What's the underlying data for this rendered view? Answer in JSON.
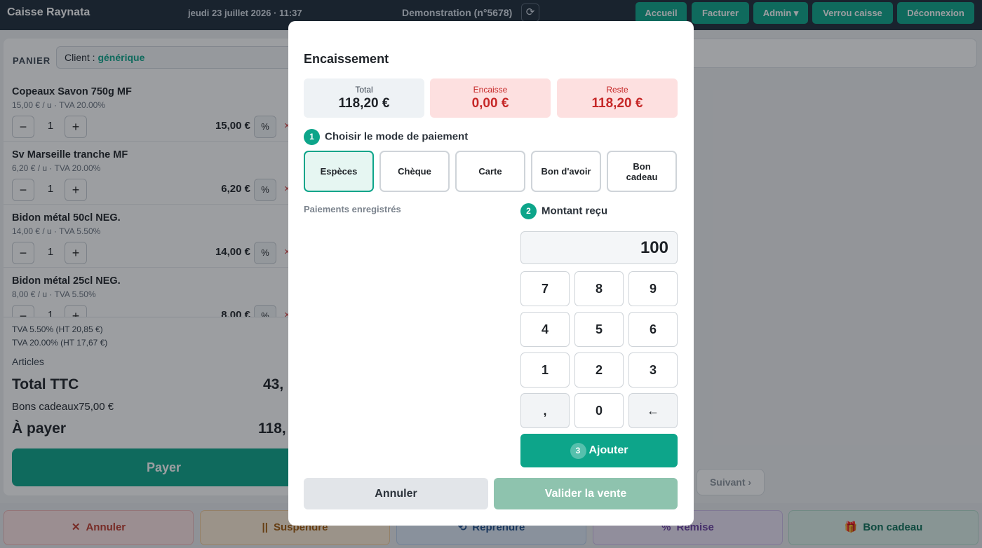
{
  "header": {
    "brand": "Caisse Raynata",
    "datetime": "jeudi 23 juillet 2026 · 11:37",
    "store": "Demonstration (n°5678)",
    "nav": [
      "Accueil",
      "Facturer",
      "Admin ▾",
      "Verrou caisse",
      "Déconnexion"
    ]
  },
  "cart": {
    "label": "PANIER",
    "client_prefix": "Client : ",
    "client_value": "générique",
    "items": [
      {
        "name": "Copeaux Savon 750g MF",
        "sub": "15,00 € / u · TVA 20.00%",
        "qty": "1",
        "price": "15,00 €"
      },
      {
        "name": "Sv Marseille tranche MF",
        "sub": "6,20 € / u · TVA 20.00%",
        "qty": "1",
        "price": "6,20 €"
      },
      {
        "name": "Bidon métal 50cl NEG.",
        "sub": "14,00 € / u · TVA 5.50%",
        "qty": "1",
        "price": "14,00 €"
      },
      {
        "name": "Bidon métal 25cl NEG.",
        "sub": "8,00 € / u · TVA 5.50%",
        "qty": "1",
        "price": "8,00 €"
      }
    ],
    "minus": "−",
    "plus": "+",
    "pct": "%",
    "del": "×",
    "tva_lines": [
      "TVA 5.50% (HT 20,85 €)",
      "TVA 20.00% (HT 17,67 €)"
    ],
    "articles": "Articles",
    "total_ttc_label": "Total TTC",
    "total_ttc_value": "43,",
    "bons_cadeaux": "Bons cadeaux75,00 €",
    "a_payer_label": "À payer",
    "a_payer_value": "118,",
    "pay_label": "Payer"
  },
  "right": {
    "suivant": "Suivant ›"
  },
  "bottom": [
    {
      "icon": "✕",
      "label": "Annuler",
      "bg": "#fde4e4",
      "border": "#f1b9b9",
      "color": "#c0392b"
    },
    {
      "icon": "||",
      "label": "Suspendre",
      "bg": "#fdecd6",
      "border": "#f2cc9b",
      "color": "#a35a0b"
    },
    {
      "icon": "⟲",
      "label": "Reprendre",
      "bg": "#dfe9f6",
      "border": "#b9cde8",
      "color": "#1f4f8a"
    },
    {
      "icon": "%",
      "label": "Remise",
      "bg": "#ece3f6",
      "border": "#cfbde8",
      "color": "#6a3fa0"
    },
    {
      "icon": "🎁",
      "label": "Bon cadeau",
      "bg": "#dcefe8",
      "border": "#b5dccd",
      "color": "#0b6e56"
    }
  ],
  "modal": {
    "title": "Encaissement",
    "summary": [
      {
        "label": "Total",
        "value": "118,20 €",
        "bg": "#eef2f5",
        "color": "#1f2328",
        "label_color": "#3a4450"
      },
      {
        "label": "Encaisse",
        "value": "0,00 €",
        "bg": "#fde0e0",
        "color": "#c62828",
        "label_color": "#c62828"
      },
      {
        "label": "Reste",
        "value": "118,20 €",
        "bg": "#fde0e0",
        "color": "#c62828",
        "label_color": "#c62828"
      }
    ],
    "step1_num": "1",
    "step1": "Choisir le mode de paiement",
    "modes": [
      "Espèces",
      "Chèque",
      "Carte",
      "Bon d'avoir",
      "Bon cadeau"
    ],
    "active_mode": "Espèces",
    "recorded": "Paiements enregistrés",
    "step2_num": "2",
    "step2": "Montant reçu",
    "amount": "100",
    "keys": [
      "7",
      "8",
      "9",
      "4",
      "5",
      "6",
      "1",
      "2",
      "3",
      ",",
      "0",
      "←"
    ],
    "step3_num": "3",
    "add": "Ajouter",
    "cancel": "Annuler",
    "validate": "Valider la vente"
  }
}
